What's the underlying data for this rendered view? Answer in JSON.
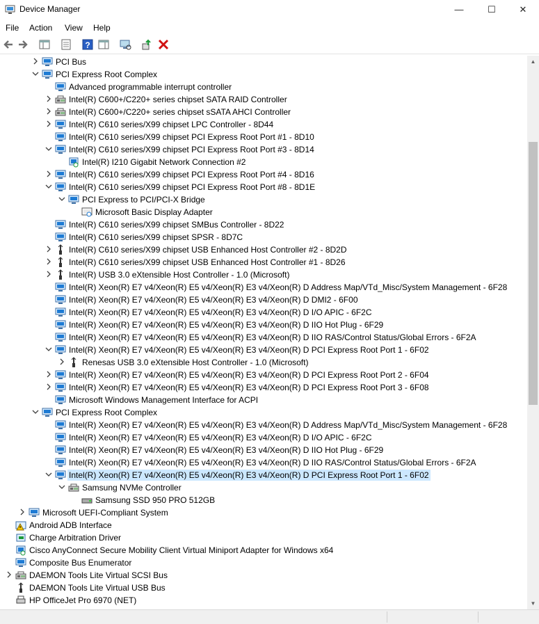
{
  "window": {
    "title": "Device Manager",
    "minimize_glyph": "—",
    "maximize_glyph": "☐",
    "close_glyph": "✕"
  },
  "menu": [
    "File",
    "Action",
    "View",
    "Help"
  ],
  "toolbar": {
    "buttons": [
      "back-icon",
      "forward-icon",
      "show-hide-console-tree-icon",
      "properties-icon",
      "help-icon",
      "action-pane-icon",
      "scan-hardware-icon",
      "update-driver-icon",
      "uninstall-device-icon"
    ]
  },
  "tree": [
    {
      "level": 3,
      "expander": "collapsed",
      "icon": "monitor",
      "label": "PCI Bus"
    },
    {
      "level": 3,
      "expander": "expanded",
      "icon": "monitor",
      "label": "PCI Express Root Complex"
    },
    {
      "level": 4,
      "expander": "none",
      "icon": "monitor",
      "label": "Advanced programmable interrupt controller"
    },
    {
      "level": 4,
      "expander": "collapsed",
      "icon": "storage",
      "label": "Intel(R) C600+/C220+ series chipset SATA RAID Controller"
    },
    {
      "level": 4,
      "expander": "collapsed",
      "icon": "storage",
      "label": "Intel(R) C600+/C220+ series chipset sSATA AHCI Controller"
    },
    {
      "level": 4,
      "expander": "collapsed",
      "icon": "monitor",
      "label": "Intel(R) C610 series/X99 chipset LPC Controller - 8D44"
    },
    {
      "level": 4,
      "expander": "none",
      "icon": "monitor",
      "label": "Intel(R) C610 series/X99 chipset PCI Express Root Port #1 - 8D10"
    },
    {
      "level": 4,
      "expander": "expanded",
      "icon": "monitor",
      "label": "Intel(R) C610 series/X99 chipset PCI Express Root Port #3 - 8D14"
    },
    {
      "level": 5,
      "expander": "none",
      "icon": "network",
      "label": "Intel(R) I210 Gigabit Network Connection #2"
    },
    {
      "level": 4,
      "expander": "collapsed",
      "icon": "monitor",
      "label": "Intel(R) C610 series/X99 chipset PCI Express Root Port #4 - 8D16"
    },
    {
      "level": 4,
      "expander": "expanded",
      "icon": "monitor",
      "label": "Intel(R) C610 series/X99 chipset PCI Express Root Port #8 - 8D1E"
    },
    {
      "level": 5,
      "expander": "expanded",
      "icon": "monitor",
      "label": "PCI Express to PCI/PCI-X Bridge"
    },
    {
      "level": 6,
      "expander": "none",
      "icon": "display",
      "label": "Microsoft Basic Display Adapter"
    },
    {
      "level": 4,
      "expander": "none",
      "icon": "monitor",
      "label": "Intel(R) C610 series/X99 chipset SMBus Controller - 8D22"
    },
    {
      "level": 4,
      "expander": "none",
      "icon": "monitor",
      "label": "Intel(R) C610 series/X99 chipset SPSR - 8D7C"
    },
    {
      "level": 4,
      "expander": "collapsed",
      "icon": "usb",
      "label": "Intel(R) C610 series/X99 chipset USB Enhanced Host Controller #2 - 8D2D"
    },
    {
      "level": 4,
      "expander": "collapsed",
      "icon": "usb",
      "label": "Intel(R) C610 series/X99 chipset USB Enhanced Host Controller #1 - 8D26"
    },
    {
      "level": 4,
      "expander": "collapsed",
      "icon": "usb",
      "label": "Intel(R) USB 3.0 eXtensible Host Controller - 1.0 (Microsoft)"
    },
    {
      "level": 4,
      "expander": "none",
      "icon": "monitor",
      "label": "Intel(R) Xeon(R) E7 v4/Xeon(R) E5 v4/Xeon(R) E3 v4/Xeon(R) D Address Map/VTd_Misc/System Management - 6F28"
    },
    {
      "level": 4,
      "expander": "none",
      "icon": "monitor",
      "label": "Intel(R) Xeon(R) E7 v4/Xeon(R) E5 v4/Xeon(R) E3 v4/Xeon(R) D DMI2 - 6F00"
    },
    {
      "level": 4,
      "expander": "none",
      "icon": "monitor",
      "label": "Intel(R) Xeon(R) E7 v4/Xeon(R) E5 v4/Xeon(R) E3 v4/Xeon(R) D I/O APIC - 6F2C"
    },
    {
      "level": 4,
      "expander": "none",
      "icon": "monitor",
      "label": "Intel(R) Xeon(R) E7 v4/Xeon(R) E5 v4/Xeon(R) E3 v4/Xeon(R) D IIO Hot Plug - 6F29"
    },
    {
      "level": 4,
      "expander": "none",
      "icon": "monitor",
      "label": "Intel(R) Xeon(R) E7 v4/Xeon(R) E5 v4/Xeon(R) E3 v4/Xeon(R) D IIO RAS/Control Status/Global Errors - 6F2A"
    },
    {
      "level": 4,
      "expander": "expanded",
      "icon": "monitor",
      "label": "Intel(R) Xeon(R) E7 v4/Xeon(R) E5 v4/Xeon(R) E3 v4/Xeon(R) D PCI Express Root Port 1 - 6F02"
    },
    {
      "level": 5,
      "expander": "collapsed",
      "icon": "usb",
      "label": "Renesas USB 3.0 eXtensible Host Controller - 1.0 (Microsoft)"
    },
    {
      "level": 4,
      "expander": "collapsed",
      "icon": "monitor",
      "label": "Intel(R) Xeon(R) E7 v4/Xeon(R) E5 v4/Xeon(R) E3 v4/Xeon(R) D PCI Express Root Port 2 - 6F04"
    },
    {
      "level": 4,
      "expander": "collapsed",
      "icon": "monitor",
      "label": "Intel(R) Xeon(R) E7 v4/Xeon(R) E5 v4/Xeon(R) E3 v4/Xeon(R) D PCI Express Root Port 3 - 6F08"
    },
    {
      "level": 4,
      "expander": "none",
      "icon": "monitor",
      "label": "Microsoft Windows Management Interface for ACPI"
    },
    {
      "level": 3,
      "expander": "expanded",
      "icon": "monitor",
      "label": "PCI Express Root Complex"
    },
    {
      "level": 4,
      "expander": "none",
      "icon": "monitor",
      "label": "Intel(R) Xeon(R) E7 v4/Xeon(R) E5 v4/Xeon(R) E3 v4/Xeon(R) D Address Map/VTd_Misc/System Management - 6F28"
    },
    {
      "level": 4,
      "expander": "none",
      "icon": "monitor",
      "label": "Intel(R) Xeon(R) E7 v4/Xeon(R) E5 v4/Xeon(R) E3 v4/Xeon(R) D I/O APIC - 6F2C"
    },
    {
      "level": 4,
      "expander": "none",
      "icon": "monitor",
      "label": "Intel(R) Xeon(R) E7 v4/Xeon(R) E5 v4/Xeon(R) E3 v4/Xeon(R) D IIO Hot Plug - 6F29"
    },
    {
      "level": 4,
      "expander": "none",
      "icon": "monitor",
      "label": "Intel(R) Xeon(R) E7 v4/Xeon(R) E5 v4/Xeon(R) E3 v4/Xeon(R) D IIO RAS/Control Status/Global Errors - 6F2A"
    },
    {
      "level": 4,
      "expander": "expanded",
      "icon": "monitor",
      "label": "Intel(R) Xeon(R) E7 v4/Xeon(R) E5 v4/Xeon(R) E3 v4/Xeon(R) D PCI Express Root Port 1 - 6F02",
      "selected": true
    },
    {
      "level": 5,
      "expander": "expanded",
      "icon": "storage",
      "label": "Samsung NVMe Controller"
    },
    {
      "level": 6,
      "expander": "none",
      "icon": "disk",
      "label": "Samsung SSD 950 PRO 512GB"
    },
    {
      "level": 2,
      "expander": "collapsed",
      "icon": "monitor",
      "label": "Microsoft UEFI-Compliant System"
    },
    {
      "level": 1,
      "expander": "none",
      "icon": "warning",
      "label": "Android ADB Interface"
    },
    {
      "level": 1,
      "expander": "none",
      "icon": "battery",
      "label": "Charge Arbitration Driver"
    },
    {
      "level": 1,
      "expander": "none",
      "icon": "network",
      "label": "Cisco AnyConnect Secure Mobility Client Virtual Miniport Adapter for Windows x64"
    },
    {
      "level": 1,
      "expander": "none",
      "icon": "monitor",
      "label": "Composite Bus Enumerator"
    },
    {
      "level": 1,
      "expander": "collapsed",
      "icon": "storage",
      "label": "DAEMON Tools Lite Virtual SCSI Bus"
    },
    {
      "level": 1,
      "expander": "none",
      "icon": "usb",
      "label": "DAEMON Tools Lite Virtual USB Bus"
    },
    {
      "level": 1,
      "expander": "none",
      "icon": "printer",
      "label": "HP OfficeJet Pro 6970 (NET)"
    }
  ],
  "colors": {
    "selection": "#cce8ff",
    "folder_blue": "#1e7bd4",
    "warning": "#f5c400"
  }
}
